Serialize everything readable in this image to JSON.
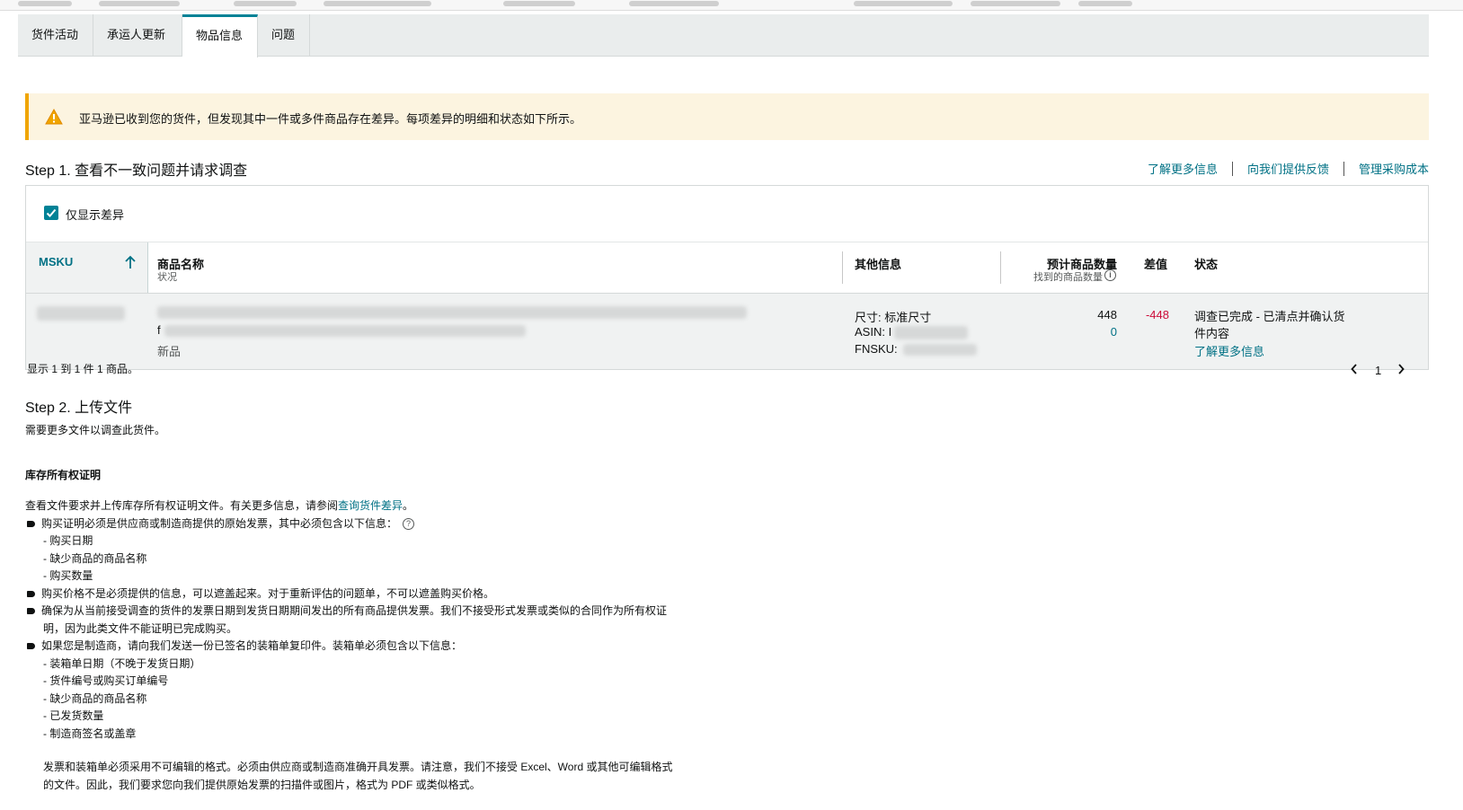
{
  "tabs": [
    "货件活动",
    "承运人更新",
    "物品信息",
    "问题"
  ],
  "active_tab_index": 2,
  "alert": {
    "icon": "warning-icon",
    "text": "亚马逊已收到您的货件，但发现其中一件或多件商品存在差异。每项差异的明细和状态如下所示。"
  },
  "step1": {
    "title": "Step 1. 查看不一致问题并请求调查",
    "links": [
      "了解更多信息",
      "向我们提供反馈",
      "管理采购成本"
    ],
    "filter_label": "仅显示差异",
    "filter_checked": true
  },
  "table": {
    "headers": {
      "msku": "MSKU",
      "name": "商品名称",
      "name_sub": "状况",
      "other": "其他信息",
      "expected": "预计商品数量",
      "found": "找到的商品数量",
      "diff": "差值",
      "status": "状态"
    },
    "row": {
      "condition": "新品",
      "name_prefix": "f",
      "size_label": "尺寸: 标准尺寸",
      "asin_label": "ASIN:",
      "asin_prefix": "I",
      "fnsku_label": "FNSKU:",
      "expected": "448",
      "found": "0",
      "diff": "-448",
      "status": "调查已完成 - 已清点并确认货件内容",
      "status_link": "了解更多信息"
    },
    "showing": "显示 1 到 1 件 1 商品。",
    "page": "1"
  },
  "step2": {
    "title": "Step 2. 上传文件",
    "subtitle": "需要更多文件以调查此货件。",
    "heading": "库存所有权证明",
    "intro": "查看文件要求并上传库存所有权证明文件。有关更多信息，请参阅",
    "intro_link": "查询货件差异",
    "intro_end": "。",
    "bullet1": "购买证明必须是供应商或制造商提供的原始发票，其中必须包含以下信息：",
    "bullet1_items": [
      "- 购买日期",
      "- 缺少商品的商品名称",
      "- 购买数量"
    ],
    "bullet2": "购买价格不是必须提供的信息，可以遮盖起来。对于重新评估的问题单，不可以遮盖购买价格。",
    "bullet3": "确保为从当前接受调查的货件的发票日期到发货日期期间发出的所有商品提供发票。我们不接受形式发票或类似的合同作为所有权证",
    "bullet3_cont": "明，因为此类文件不能证明已完成购买。",
    "bullet4": "如果您是制造商，请向我们发送一份已签名的装箱单复印件。装箱单必须包含以下信息：",
    "bullet4_items": [
      "- 装箱单日期（不晚于发货日期）",
      "- 货件编号或购买订单编号",
      "- 缺少商品的商品名称",
      "- 已发货数量",
      "- 制造商签名或盖章"
    ],
    "footer1": "发票和装箱单必须采用不可编辑的格式。必须由供应商或制造商准确开具发票。请注意，我们不接受 Excel、Word 或其他可编辑格式",
    "footer2": "的文件。因此，我们要求您向我们提供原始发票的扫描件或图片，格式为 PDF 或类似格式。"
  },
  "colors": {
    "teal": "#008296",
    "link": "#007185",
    "negative": "#cc0c39",
    "alert_bg": "#fcf4e0",
    "warning": "#f0a500"
  }
}
